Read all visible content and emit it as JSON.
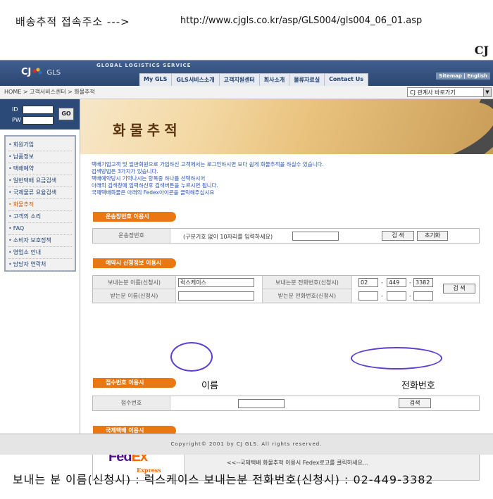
{
  "annotation": {
    "top_caption": "배송추적 접속주소 --->",
    "url": "http://www.cjgls.co.kr/asp/GLS004/gls004_06_01.asp",
    "corner_logo": "CJ",
    "bottom_caption": "보내는 분 이름(신청시) : 럭스케이스   보내는분 전화번호(신청시) : 02-449-3382",
    "handwritten_name": "이름",
    "handwritten_phone": "전화번호",
    "circle_color": "#5b3fcf"
  },
  "header": {
    "logo_cj": "CJ",
    "logo_gls": "GLS",
    "service_title": "GLOBAL LOGISTICS SERVICE",
    "nav": [
      "My GLS",
      "GLS서비스소개",
      "고객지원센터",
      "회사소개",
      "물류자료실",
      "Contact Us"
    ],
    "sitemap": "Sitemap | English"
  },
  "breadcrumb": "HOME > 고객서비스센터 > 화물추적",
  "related_select": "CJ 관계사 바로가기",
  "login": {
    "id_label": "ID",
    "pw_label": "PW",
    "go": "GO"
  },
  "sidebar": [
    "회원가입",
    "납품정보",
    "택배예약",
    "일반택배 요금검색",
    "국제물류 요율검색",
    "화물추적",
    "고객의 소리",
    "FAQ",
    "소비자 보호정책",
    "영업소 안내",
    "담당자 연락처"
  ],
  "banner_title": "화물추적",
  "intro": [
    "택배기업고객 및 일반회원으로 가입하신 고객께서는 로그인하시면 보다 쉽게 화물추적을 하실수 있습니다.",
    "검색방법은 3가지가 있습니다.",
    "택배예약당시 기억나시는 항목중 하나를 선택하시어",
    "아래의 검색창에 입력하신후 검색버튼을 누르시면 됩니다.",
    "국제택배화물은 아래의 Fedex아이콘을 클릭해주십시요"
  ],
  "sec1": {
    "title": "운송장번호 이용시",
    "label": "운송장번호",
    "hint": "(구분기호 없이 10자리를 입력하세요)",
    "search": "검 색",
    "reset": "초기화"
  },
  "sec2": {
    "title": "예약시 신청정보 이용시",
    "sender_name_label": "보내는분 이름(신청시)",
    "sender_name_value": "럭스케이스",
    "receiver_name_label": "받는분 이름(신청시)",
    "sender_phone_label": "보내는분 전화번호(신청시)",
    "sender_phone": [
      "02",
      "449",
      "3382"
    ],
    "receiver_phone_label": "받는분 전화번호(신청시)",
    "dash": "-",
    "search": "검 색"
  },
  "sec3": {
    "title": "접수번호 이용시",
    "label": "접수번호",
    "search": "검색"
  },
  "sec4": {
    "title": "국제택배 이용시",
    "fedex_fe": "Fed",
    "fedex_ex": "Ex",
    "fedex_express": "Express",
    "message": "<<--국제택배 화물추적 이용시 Fedex로고를 클릭하세요..."
  },
  "footer": "Copyright© 2001 by CJ GLS. All rights reserved."
}
